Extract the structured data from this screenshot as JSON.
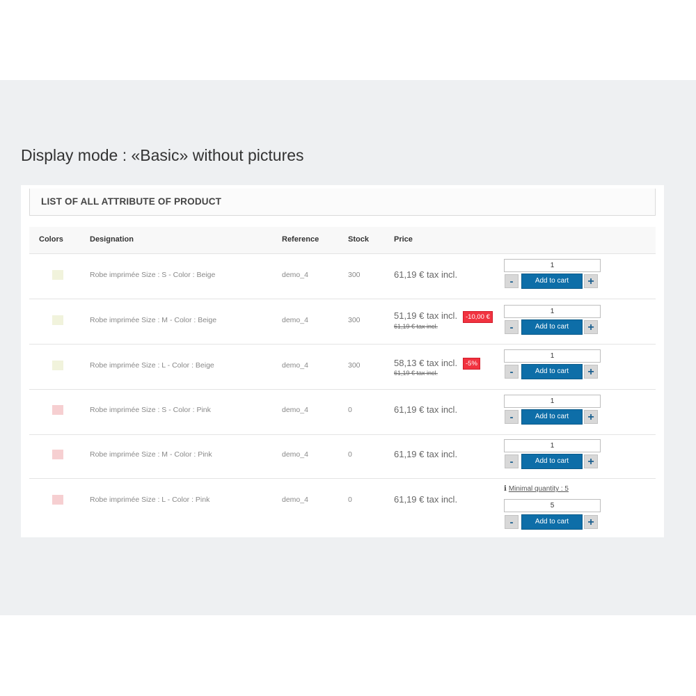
{
  "mode_title": "Display mode : «Basic» without pictures",
  "panel_title": "LIST OF ALL ATTRIBUTE OF PRODUCT",
  "columns": [
    "Colors",
    "Designation",
    "Reference",
    "Stock",
    "Price"
  ],
  "colors": {
    "beige": "#f1f3dc",
    "pink": "#f6cfd1",
    "cart_button": "#0e6ea8",
    "discount_badge": "#f13340"
  },
  "add_to_cart_label": "Add to cart",
  "minus_label": "-",
  "plus_label": "+",
  "rows": [
    {
      "color": "beige",
      "designation": "Robe imprimée Size : S - Color : Beige",
      "reference": "demo_4",
      "stock": "300",
      "price": "61,19 € tax incl.",
      "qty": "1"
    },
    {
      "color": "beige",
      "designation": "Robe imprimée Size : M - Color : Beige",
      "reference": "demo_4",
      "stock": "300",
      "price": "51,19 € tax incl.",
      "old_price": "61,19 € tax incl.",
      "badge": "-10,00 €",
      "qty": "1"
    },
    {
      "color": "beige",
      "designation": "Robe imprimée Size : L - Color : Beige",
      "reference": "demo_4",
      "stock": "300",
      "price": "58,13 € tax incl.",
      "old_price": "61,19 € tax incl.",
      "badge": "-5%",
      "qty": "1"
    },
    {
      "color": "pink",
      "designation": "Robe imprimée Size : S - Color : Pink",
      "reference": "demo_4",
      "stock": "0",
      "price": "61,19 € tax incl.",
      "qty": "1"
    },
    {
      "color": "pink",
      "designation": "Robe imprimée Size : M - Color : Pink",
      "reference": "demo_4",
      "stock": "0",
      "price": "61,19 € tax incl.",
      "qty": "1"
    },
    {
      "color": "pink",
      "designation": "Robe imprimée Size : L - Color : Pink",
      "reference": "demo_4",
      "stock": "0",
      "price": "61,19 € tax incl.",
      "min_qty_label": "Minimal quantity : 5",
      "qty": "5"
    }
  ]
}
